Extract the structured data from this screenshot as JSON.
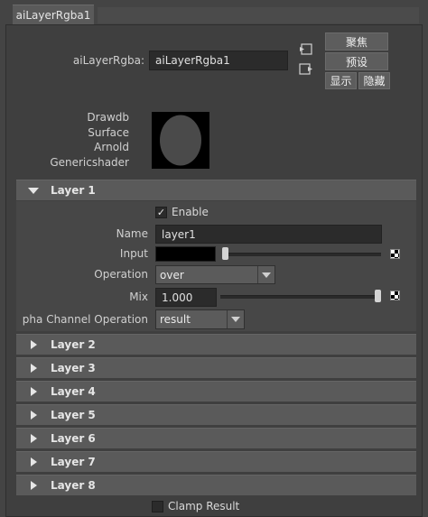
{
  "tab": {
    "label": "aiLayerRgba1"
  },
  "node": {
    "name_label": "aiLayerRgba:",
    "name_value": "aiLayerRgba1"
  },
  "actions": {
    "focus": "聚焦",
    "presets": "预设",
    "show": "显示",
    "hide": "隐藏"
  },
  "swatch_labels": [
    "Drawdb",
    "Surface",
    "Arnold",
    "Genericshader"
  ],
  "layer1": {
    "title": "Layer 1",
    "enable_label": "Enable",
    "enable_checked": "✓",
    "name_label": "Name",
    "name_value": "layer1",
    "input_label": "Input",
    "operation_label": "Operation",
    "operation_value": "over",
    "mix_label": "Mix",
    "mix_value": "1.000",
    "mix_level": 1.0,
    "input_level": 0.0,
    "alpha_label": "pha Channel Operation",
    "alpha_value": "result"
  },
  "layers": [
    "Layer 2",
    "Layer 3",
    "Layer 4",
    "Layer 5",
    "Layer 6",
    "Layer 7",
    "Layer 8"
  ],
  "clamp": {
    "label": "Clamp Result"
  }
}
